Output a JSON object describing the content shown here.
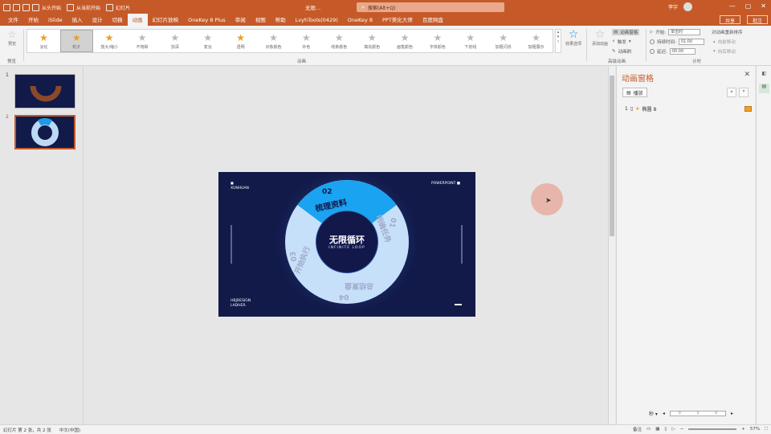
{
  "titlebar": {
    "quick_access": [
      "从头开始",
      "从当前开始",
      "幻灯片"
    ],
    "doc_title": "无限...",
    "search_placeholder": "搜索(Alt+Q)",
    "user": "李宇",
    "min": "—",
    "max": "▢",
    "close": "✕"
  },
  "tabs": [
    "文件",
    "开始",
    "iSlide",
    "插入",
    "设计",
    "切换",
    "动画",
    "幻灯片放映",
    "OneKey 8 Plus",
    "审阅",
    "视图",
    "帮助",
    "LvyhTools(0429)",
    "OneKey 8",
    "PPT美化大师",
    "百度网盘"
  ],
  "active_tab": "动画",
  "share": "共享",
  "comment": "批注",
  "ribbon": {
    "preview": "预览",
    "preview_group": "预览",
    "animation_group": "动画",
    "advanced_group": "高级动画",
    "timing_group": "计时",
    "gallery": [
      {
        "label": "淡化",
        "style": "gold",
        "selected": false
      },
      {
        "label": "轮子",
        "style": "gold",
        "selected": true
      },
      {
        "label": "放大/缩小",
        "style": "gold",
        "selected": false
      },
      {
        "label": "不饱和",
        "style": "gray",
        "selected": false
      },
      {
        "label": "加深",
        "style": "gray",
        "selected": false
      },
      {
        "label": "变淡",
        "style": "gray",
        "selected": false
      },
      {
        "label": "透明",
        "style": "gold",
        "selected": false
      },
      {
        "label": "对象颜色",
        "style": "gray",
        "selected": false
      },
      {
        "label": "补色",
        "style": "gray",
        "selected": false
      },
      {
        "label": "线条颜色",
        "style": "gray",
        "selected": false
      },
      {
        "label": "填充颜色",
        "style": "gray",
        "selected": false
      },
      {
        "label": "画笔颜色",
        "style": "gray",
        "selected": false
      },
      {
        "label": "字体颜色",
        "style": "gray",
        "selected": false
      },
      {
        "label": "下划线",
        "style": "gray",
        "selected": false
      },
      {
        "label": "加粗闪烁",
        "style": "gray",
        "selected": false
      },
      {
        "label": "加粗展示",
        "style": "gray",
        "selected": false
      }
    ],
    "effect_options": "效果选项",
    "add_animation": "添加动画",
    "animation_pane": "动画窗格",
    "trigger": "触发",
    "animation_painter": "动画刷",
    "start_label": "开始:",
    "start_value": "单击时",
    "duration_label": "持续时间:",
    "duration_value": "01.00",
    "delay_label": "延迟:",
    "delay_value": "00.00",
    "reorder": "对动画重新排序",
    "move_earlier": "向前移动",
    "move_later": "向后移动"
  },
  "slides": [
    {
      "num": "1",
      "selected": false
    },
    {
      "num": "2",
      "selected": true
    }
  ],
  "slide": {
    "top_left_1": "■",
    "top_left_2": "XUNHUAN",
    "top_right": "POWERPOINT ■",
    "center_title": "无限循环",
    "center_sub": "INFINITE LOOP",
    "seg1_num": "01",
    "seg1_text": "明确任务",
    "seg2_num": "02",
    "seg2_text": "梳理资料",
    "seg3_num": "03",
    "seg3_text": "开始执行",
    "seg4_num": "04",
    "seg4_text": "总结复盘",
    "bottom_left_1": "HBJDESIGN",
    "bottom_left_2": "LADHER."
  },
  "anim_pane": {
    "title": "动画窗格",
    "close": "✕",
    "play": "播放",
    "item_index": "1",
    "item_label": "椭圆 8"
  },
  "pane_bottom": {
    "seconds": "秒 ▾",
    "ticks": [
      "0",
      "2",
      "4"
    ]
  },
  "status": {
    "slide_info": "幻灯片 第 2 张，共 2 张",
    "lang": "中文(中国)",
    "notes": "备注",
    "zoom": "57%"
  }
}
